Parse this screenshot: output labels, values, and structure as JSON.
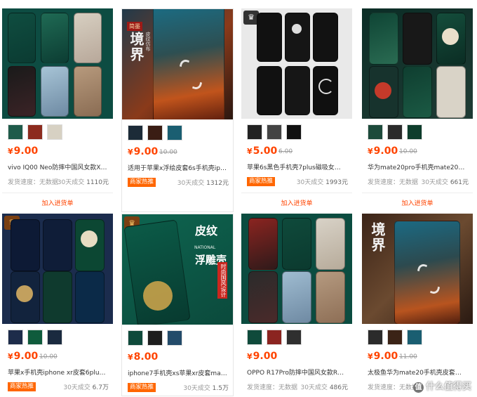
{
  "products": [
    {
      "price": "9.00",
      "orig": "",
      "title": "vivo IQ00 Neo防摔中国风女款X27Pro...",
      "left": "发货速度：无数据",
      "sales_label": "30天成交",
      "sales": "1110元",
      "badge": "",
      "add": "加入进货单",
      "image": "phone-case-green-floral",
      "thumb_colors": [
        "#1f5b4a",
        "#8c2b1e",
        "#d7d1c3"
      ]
    },
    {
      "price": "9.00",
      "orig": "10.00",
      "title": "适用于苹果x浮绘皮套6s手机壳iphone...",
      "left": "",
      "sales_label": "30天成交",
      "sales": "1312元",
      "badge": "商家热推",
      "add": "",
      "image": "phone-case-koi-orange",
      "thumb_colors": [
        "#1c2b38",
        "#3a1d14",
        "#1a5e71"
      ],
      "brand_tag": "简墨",
      "brand_char": "境界",
      "brand_sub": "皮纹仿布"
    },
    {
      "price": "5.00",
      "orig": "6.00",
      "title": "苹果6s黑色手机壳7plus磁吸女个性六...",
      "left": "",
      "sales_label": "30天成交",
      "sales": "1993元",
      "badge": "商家热推",
      "add": "加入进货单",
      "image": "phone-case-black-moon",
      "thumb_colors": [
        "#222",
        "#444",
        "#111"
      ]
    },
    {
      "price": "9.00",
      "orig": "10.00",
      "title": "华为mate20pro手机壳mate20皮纹20x...",
      "left": "发货速度：无数据",
      "sales_label": "30天成交",
      "sales": "661元",
      "badge": "",
      "add": "加入进货单",
      "image": "phone-case-dragon-green",
      "thumb_colors": [
        "#1d4a3b",
        "#2b2b2b",
        "#0e3d2c"
      ]
    },
    {
      "price": "9.00",
      "orig": "10.00",
      "title": "苹果x手机壳iphone xr皮套6plus浮雕...",
      "left": "",
      "sales_label": "30天成交",
      "sales": "6.7万",
      "badge": "商家热推",
      "add": "",
      "image": "phone-case-navy-dragon",
      "thumb_colors": [
        "#1d2c4a",
        "#0f5b3c",
        "#1a2a3f"
      ]
    },
    {
      "price": "8.00",
      "orig": "",
      "title": "iphone7手机壳xs苹果xr皮套max华为...",
      "left": "",
      "sales_label": "30天成交",
      "sales": "1.5万",
      "badge": "商家热推",
      "add": "",
      "image": "phone-case-green-embroidery",
      "thumb_colors": [
        "#0f4a3b",
        "#1e1e1e",
        "#234b6a"
      ],
      "brand_char1": "皮纹",
      "brand_en": "NATIONAL",
      "brand_char2": "浮雕壳",
      "brand_banner": "时尚国风设计"
    },
    {
      "price": "9.00",
      "orig": "",
      "title": "OPPO R17Pro防摔中国风女款R17手...",
      "left": "发货速度：无数据",
      "sales_label": "30天成交",
      "sales": "486元",
      "badge": "",
      "add": "",
      "image": "phone-case-green-floral-oppo",
      "thumb_colors": [
        "#0f4a3b",
        "#8b2420",
        "#2f2f2f"
      ]
    },
    {
      "price": "9.00",
      "orig": "11.00",
      "title": "太极鱼华为mate20手机壳皮套mate20...",
      "left": "发货速度：无数据",
      "sales_label": "",
      "sales": "",
      "badge": "",
      "add": "",
      "image": "phone-case-koi-brown",
      "thumb_colors": [
        "#2b2b2b",
        "#3b2316",
        "#1a5e71"
      ],
      "brand_char": "境界"
    }
  ],
  "watermark": "什么值得买"
}
